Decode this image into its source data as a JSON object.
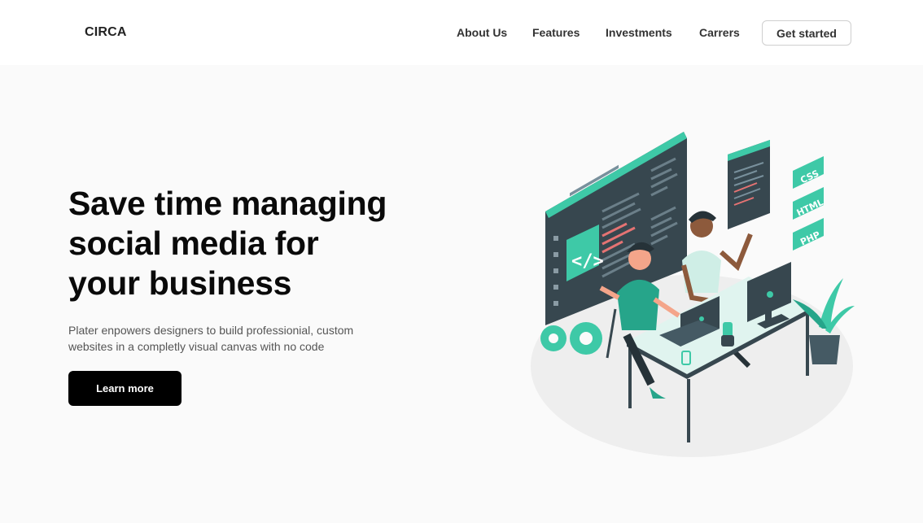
{
  "nav": {
    "logo": "CIRCA",
    "items": [
      {
        "label": "About Us"
      },
      {
        "label": "Features"
      },
      {
        "label": "Investments"
      },
      {
        "label": "Carrers"
      }
    ],
    "cta_label": "Get started"
  },
  "hero": {
    "title_lines": [
      "Save time managing",
      "social media for",
      "your business"
    ],
    "subtitle_lines": [
      "Plater enpowers designers to build professionial, custom",
      "websites in a completly visual canvas with no code"
    ],
    "button_label": "Learn more"
  },
  "illustration": {
    "badges": [
      "CSS",
      "HTML",
      "PHP"
    ],
    "code_tag": "</>",
    "accent": "#3ec9a7",
    "dark": "#37474f"
  }
}
